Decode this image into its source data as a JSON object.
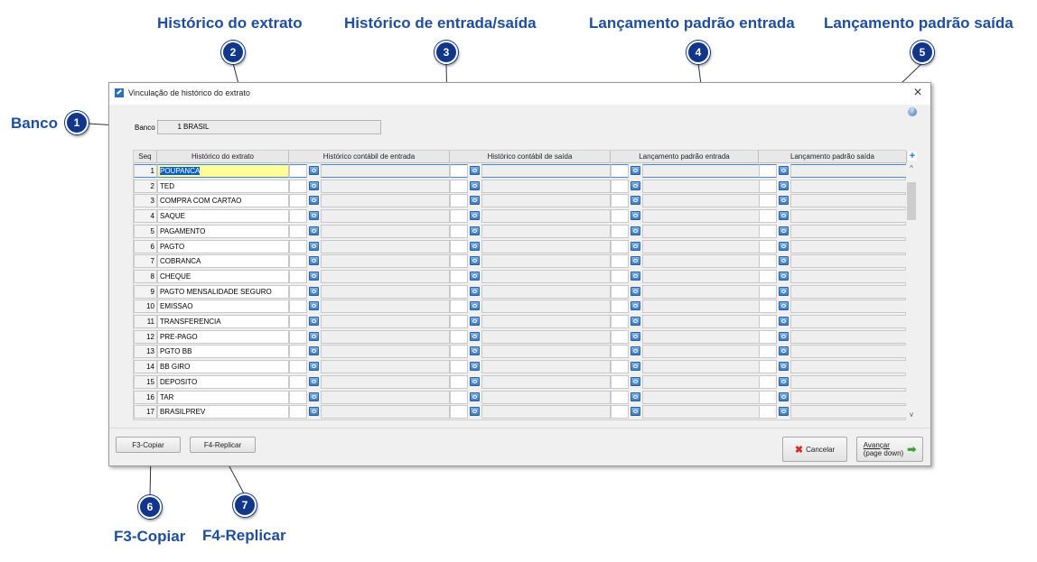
{
  "callouts": {
    "banco": "Banco",
    "historico_extrato": "Histórico do extrato",
    "historico_entrada_saida": "Histórico de entrada/saída",
    "lanc_padrao_entrada": "Lançamento padrão entrada",
    "lanc_padrao_saida": "Lançamento padrão saída",
    "f3": "F3-Copiar",
    "f4": "F4-Replicar"
  },
  "badges": [
    "1",
    "2",
    "3",
    "4",
    "5",
    "6",
    "7"
  ],
  "window": {
    "title": "Vinculação de histórico do extrato",
    "close": "×",
    "help": "?"
  },
  "banco": {
    "label": "Banco",
    "number": "1",
    "name": "BRASIL"
  },
  "grid": {
    "headers": [
      "Seq",
      "Histórico do extrato",
      "Histórico contábil de entrada",
      "Histórico contábil de saída",
      "Lançamento padrão entrada",
      "Lançamento padrão saída"
    ],
    "add": "+",
    "scroll_up": "^",
    "scroll_down": "v",
    "rows": [
      {
        "seq": "1",
        "hist": "POUPANCA"
      },
      {
        "seq": "2",
        "hist": "TED"
      },
      {
        "seq": "3",
        "hist": "COMPRA COM CARTAO"
      },
      {
        "seq": "4",
        "hist": "SAQUE"
      },
      {
        "seq": "5",
        "hist": "PAGAMENTO"
      },
      {
        "seq": "6",
        "hist": "PAGTO"
      },
      {
        "seq": "7",
        "hist": "COBRANCA"
      },
      {
        "seq": "8",
        "hist": "CHEQUE"
      },
      {
        "seq": "9",
        "hist": "PAGTO MENSALIDADE SEGURO"
      },
      {
        "seq": "10",
        "hist": "EMISSAO"
      },
      {
        "seq": "11",
        "hist": "TRANSFERENCIA"
      },
      {
        "seq": "12",
        "hist": "PRE-PAGO"
      },
      {
        "seq": "13",
        "hist": "PGTO BB"
      },
      {
        "seq": "14",
        "hist": "BB GIRO"
      },
      {
        "seq": "15",
        "hist": "DEPOSITO"
      },
      {
        "seq": "16",
        "hist": "TAR"
      },
      {
        "seq": "17",
        "hist": "BRASILPREV"
      }
    ]
  },
  "buttons": {
    "f3": "F3-Copiar",
    "f4": "F4-Replicar",
    "cancelar": "Cancelar",
    "avancar_1": "Avançar",
    "avancar_2": "(page down)"
  },
  "colors": {
    "callout": "#1f4e9c",
    "badge": "#12378a",
    "selection": "#ffff9a"
  }
}
